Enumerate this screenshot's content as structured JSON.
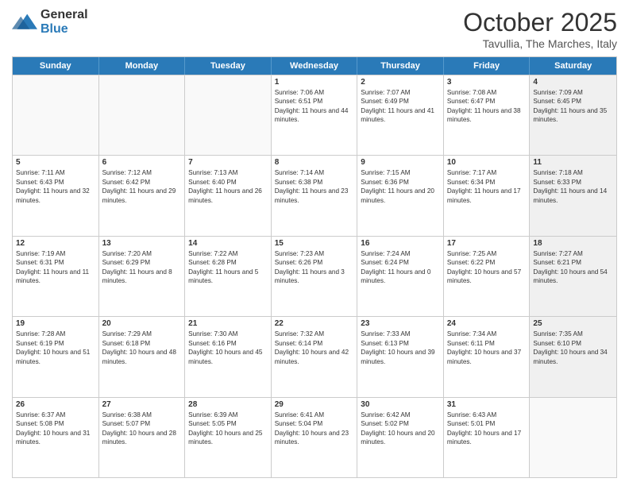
{
  "logo": {
    "general": "General",
    "blue": "Blue"
  },
  "title": {
    "month": "October 2025",
    "location": "Tavullia, The Marches, Italy"
  },
  "days": [
    "Sunday",
    "Monday",
    "Tuesday",
    "Wednesday",
    "Thursday",
    "Friday",
    "Saturday"
  ],
  "weeks": [
    [
      {
        "day": "",
        "text": "",
        "empty": true
      },
      {
        "day": "",
        "text": "",
        "empty": true
      },
      {
        "day": "",
        "text": "",
        "empty": true
      },
      {
        "day": "1",
        "text": "Sunrise: 7:06 AM\nSunset: 6:51 PM\nDaylight: 11 hours and 44 minutes.",
        "empty": false
      },
      {
        "day": "2",
        "text": "Sunrise: 7:07 AM\nSunset: 6:49 PM\nDaylight: 11 hours and 41 minutes.",
        "empty": false
      },
      {
        "day": "3",
        "text": "Sunrise: 7:08 AM\nSunset: 6:47 PM\nDaylight: 11 hours and 38 minutes.",
        "empty": false
      },
      {
        "day": "4",
        "text": "Sunrise: 7:09 AM\nSunset: 6:45 PM\nDaylight: 11 hours and 35 minutes.",
        "empty": false
      }
    ],
    [
      {
        "day": "5",
        "text": "Sunrise: 7:11 AM\nSunset: 6:43 PM\nDaylight: 11 hours and 32 minutes.",
        "empty": false
      },
      {
        "day": "6",
        "text": "Sunrise: 7:12 AM\nSunset: 6:42 PM\nDaylight: 11 hours and 29 minutes.",
        "empty": false
      },
      {
        "day": "7",
        "text": "Sunrise: 7:13 AM\nSunset: 6:40 PM\nDaylight: 11 hours and 26 minutes.",
        "empty": false
      },
      {
        "day": "8",
        "text": "Sunrise: 7:14 AM\nSunset: 6:38 PM\nDaylight: 11 hours and 23 minutes.",
        "empty": false
      },
      {
        "day": "9",
        "text": "Sunrise: 7:15 AM\nSunset: 6:36 PM\nDaylight: 11 hours and 20 minutes.",
        "empty": false
      },
      {
        "day": "10",
        "text": "Sunrise: 7:17 AM\nSunset: 6:34 PM\nDaylight: 11 hours and 17 minutes.",
        "empty": false
      },
      {
        "day": "11",
        "text": "Sunrise: 7:18 AM\nSunset: 6:33 PM\nDaylight: 11 hours and 14 minutes.",
        "empty": false
      }
    ],
    [
      {
        "day": "12",
        "text": "Sunrise: 7:19 AM\nSunset: 6:31 PM\nDaylight: 11 hours and 11 minutes.",
        "empty": false
      },
      {
        "day": "13",
        "text": "Sunrise: 7:20 AM\nSunset: 6:29 PM\nDaylight: 11 hours and 8 minutes.",
        "empty": false
      },
      {
        "day": "14",
        "text": "Sunrise: 7:22 AM\nSunset: 6:28 PM\nDaylight: 11 hours and 5 minutes.",
        "empty": false
      },
      {
        "day": "15",
        "text": "Sunrise: 7:23 AM\nSunset: 6:26 PM\nDaylight: 11 hours and 3 minutes.",
        "empty": false
      },
      {
        "day": "16",
        "text": "Sunrise: 7:24 AM\nSunset: 6:24 PM\nDaylight: 11 hours and 0 minutes.",
        "empty": false
      },
      {
        "day": "17",
        "text": "Sunrise: 7:25 AM\nSunset: 6:22 PM\nDaylight: 10 hours and 57 minutes.",
        "empty": false
      },
      {
        "day": "18",
        "text": "Sunrise: 7:27 AM\nSunset: 6:21 PM\nDaylight: 10 hours and 54 minutes.",
        "empty": false
      }
    ],
    [
      {
        "day": "19",
        "text": "Sunrise: 7:28 AM\nSunset: 6:19 PM\nDaylight: 10 hours and 51 minutes.",
        "empty": false
      },
      {
        "day": "20",
        "text": "Sunrise: 7:29 AM\nSunset: 6:18 PM\nDaylight: 10 hours and 48 minutes.",
        "empty": false
      },
      {
        "day": "21",
        "text": "Sunrise: 7:30 AM\nSunset: 6:16 PM\nDaylight: 10 hours and 45 minutes.",
        "empty": false
      },
      {
        "day": "22",
        "text": "Sunrise: 7:32 AM\nSunset: 6:14 PM\nDaylight: 10 hours and 42 minutes.",
        "empty": false
      },
      {
        "day": "23",
        "text": "Sunrise: 7:33 AM\nSunset: 6:13 PM\nDaylight: 10 hours and 39 minutes.",
        "empty": false
      },
      {
        "day": "24",
        "text": "Sunrise: 7:34 AM\nSunset: 6:11 PM\nDaylight: 10 hours and 37 minutes.",
        "empty": false
      },
      {
        "day": "25",
        "text": "Sunrise: 7:35 AM\nSunset: 6:10 PM\nDaylight: 10 hours and 34 minutes.",
        "empty": false
      }
    ],
    [
      {
        "day": "26",
        "text": "Sunrise: 6:37 AM\nSunset: 5:08 PM\nDaylight: 10 hours and 31 minutes.",
        "empty": false
      },
      {
        "day": "27",
        "text": "Sunrise: 6:38 AM\nSunset: 5:07 PM\nDaylight: 10 hours and 28 minutes.",
        "empty": false
      },
      {
        "day": "28",
        "text": "Sunrise: 6:39 AM\nSunset: 5:05 PM\nDaylight: 10 hours and 25 minutes.",
        "empty": false
      },
      {
        "day": "29",
        "text": "Sunrise: 6:41 AM\nSunset: 5:04 PM\nDaylight: 10 hours and 23 minutes.",
        "empty": false
      },
      {
        "day": "30",
        "text": "Sunrise: 6:42 AM\nSunset: 5:02 PM\nDaylight: 10 hours and 20 minutes.",
        "empty": false
      },
      {
        "day": "31",
        "text": "Sunrise: 6:43 AM\nSunset: 5:01 PM\nDaylight: 10 hours and 17 minutes.",
        "empty": false
      },
      {
        "day": "",
        "text": "",
        "empty": true
      }
    ]
  ]
}
